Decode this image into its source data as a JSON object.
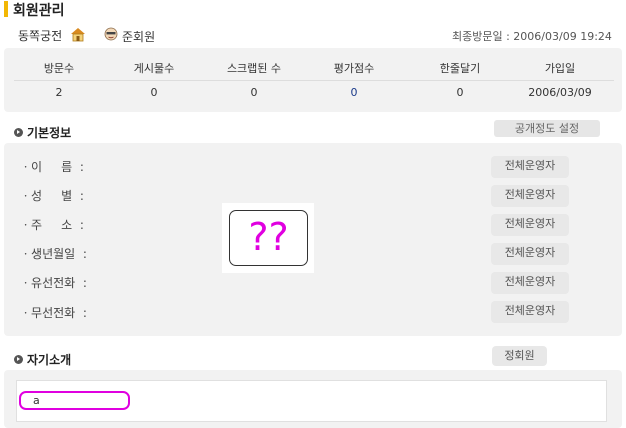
{
  "header": {
    "title": "회원관리",
    "club_name": "동쪽궁전",
    "member_level": "준회원",
    "last_visit": "최종방문일 : 2006/03/09 19:24"
  },
  "stats": [
    {
      "label": "방문수",
      "value": "2"
    },
    {
      "label": "게시물수",
      "value": "0"
    },
    {
      "label": "스크랩된 수",
      "value": "0"
    },
    {
      "label": "평가점수",
      "value": "0"
    },
    {
      "label": "한줄달기",
      "value": "0"
    },
    {
      "label": "가입일",
      "value": "2006/03/09"
    }
  ],
  "basic_info": {
    "title": "기본정보",
    "disclosure_button": "공개정도 설정",
    "fields": [
      {
        "label": "ㆍ이     름  :",
        "visibility": "전체운영자"
      },
      {
        "label": "ㆍ성     별  :",
        "visibility": "전체운영자"
      },
      {
        "label": "ㆍ주     소  :",
        "visibility": "전체운영자"
      },
      {
        "label": "ㆍ생년월일  :",
        "visibility": "전체운영자"
      },
      {
        "label": "ㆍ유선전화  :",
        "visibility": "전체운영자"
      },
      {
        "label": "ㆍ무선전화  :",
        "visibility": "전체운영자"
      }
    ],
    "placeholder": "??"
  },
  "self_intro": {
    "title": "자기소개",
    "visibility": "정회원",
    "text": "a"
  },
  "colors": {
    "accent": "#f2b705",
    "annotation": "#e000e0",
    "panel": "#f2f2f2"
  }
}
